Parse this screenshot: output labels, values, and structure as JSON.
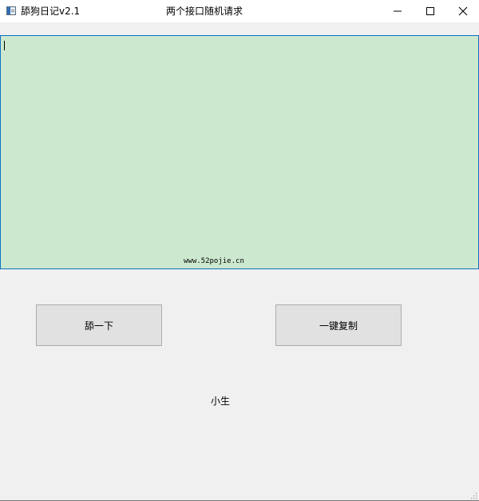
{
  "window": {
    "app_title": "舔狗日记v2.1",
    "center_title": "两个接口随机请求",
    "controls": {
      "minimize_icon": "minimize-icon",
      "maximize_icon": "maximize-icon",
      "close_icon": "close-icon"
    }
  },
  "content": {
    "text_value": "",
    "watermark": "www.52pojie.cn",
    "background_color": "#cce8cf",
    "border_color": "#0f72c4"
  },
  "buttons": {
    "lick_label": "舔一下",
    "copy_label": "一键复制"
  },
  "footer": {
    "label": "小生"
  }
}
